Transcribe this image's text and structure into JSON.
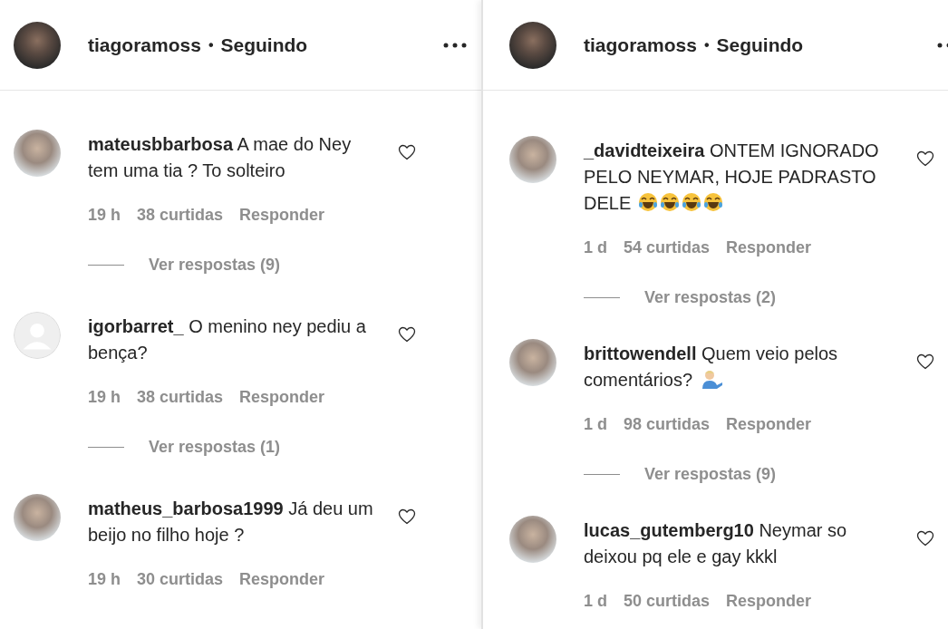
{
  "panels": [
    {
      "header": {
        "avatar": {
          "kind": "photo"
        },
        "username": "tiagoramoss",
        "separator": "•",
        "follow_status": "Seguindo"
      },
      "comments": [
        {
          "avatar": {
            "kind": "photo"
          },
          "text": "**mateusbbarbosa** A mae do Ney tem uma tia ? To solteiro",
          "time": "19 h",
          "likes": "38 curtidas",
          "reply": "Responder",
          "replies": "Ver respostas (9)",
          "liked": false
        },
        {
          "avatar": {
            "kind": "default"
          },
          "text": "**igorbarret_** O menino ney pediu a bença?",
          "time": "19 h",
          "likes": "38 curtidas",
          "reply": "Responder",
          "replies": "Ver respostas (1)",
          "liked": false
        },
        {
          "avatar": {
            "kind": "photo"
          },
          "text": "**matheus_barbosa1999** Já deu um beijo no filho hoje ?",
          "time": "19 h",
          "likes": "30 curtidas",
          "reply": "Responder",
          "liked": false
        }
      ]
    },
    {
      "header": {
        "avatar": {
          "kind": "photo"
        },
        "username": "tiagoramoss",
        "separator": "•",
        "follow_status": "Seguindo"
      },
      "comments": [
        {
          "avatar": {
            "kind": "photo"
          },
          "text": "**_davidteixeira** ONTEM IGNORADO PELO NEYMAR, HOJE PADRASTO DELE",
          "emojis": [
            {
              "kind": "laughing"
            },
            {
              "kind": "laughing"
            },
            {
              "kind": "laughing"
            },
            {
              "kind": "laughing"
            }
          ],
          "time": "1 d",
          "likes": "54 curtidas",
          "reply": "Responder",
          "replies": "Ver respostas (2)",
          "liked": false
        },
        {
          "avatar": {
            "kind": "photo"
          },
          "text": "**brittowendell** Quem veio pelos comentários?",
          "emojis": [
            {
              "kind": "person"
            }
          ],
          "time": "1 d",
          "likes": "98 curtidas",
          "reply": "Responder",
          "replies": "Ver respostas (9)",
          "liked": false
        },
        {
          "avatar": {
            "kind": "photo"
          },
          "text": "**lucas_gutemberg10** Neymar so deixou pq ele e gay kkkl",
          "time": "1 d",
          "likes": "50 curtidas",
          "reply": "Responder",
          "liked": false
        }
      ]
    }
  ]
}
